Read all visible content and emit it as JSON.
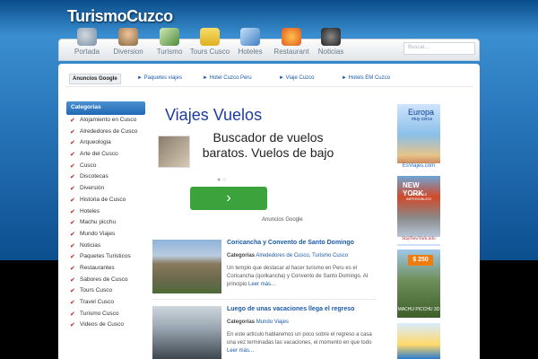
{
  "site": {
    "logo_text": "TurismoCuzco"
  },
  "nav": {
    "items": [
      {
        "label": "Portada",
        "icon": "home-icon",
        "color": "#7a8fa3"
      },
      {
        "label": "Diversion",
        "icon": "people-icon",
        "color": "#8c6b45"
      },
      {
        "label": "Turismo",
        "icon": "map-icon",
        "color": "#4f8b3a"
      },
      {
        "label": "Tours Cusco",
        "icon": "bus-icon",
        "color": "#e0b020"
      },
      {
        "label": "Hoteles",
        "icon": "hotel-icon",
        "color": "#3f7fc4"
      },
      {
        "label": "Restaurant",
        "icon": "food-icon",
        "color": "#e05a22"
      },
      {
        "label": "Noticias",
        "icon": "camera-icon",
        "color": "#333333"
      }
    ],
    "search_placeholder": "Buscar..."
  },
  "ads_bar": {
    "title": "Anuncios Google",
    "links": [
      "► Paquetes viajes",
      "► Hotel Cuzco Peru",
      "► Viaje Cuzco",
      "► Hotels EM Cuzco"
    ]
  },
  "sidebar": {
    "heading": "Categorias",
    "items": [
      "Alojamiento en Cusco",
      "Alrededores de Cusco",
      "Arqueologia",
      "Arte del Cusco",
      "Cusco",
      "Discotecas",
      "Diversión",
      "Historia de Cusco",
      "Hoteles",
      "Machu picchu",
      "Mundo Viajes",
      "Noticias",
      "Paquetes Turisticos",
      "Restaurantes",
      "Sabores de Cusco",
      "Tours Cusco",
      "Travel Cusco",
      "Turismo Cusco",
      "Videos de Cusco"
    ]
  },
  "google_ad": {
    "title": "Viajes Vuelos",
    "text": "Buscador de vuelos baratos. Vuelos de bajo",
    "button_label": "›",
    "dots": "● ○",
    "branding": "Anuncios Google"
  },
  "posts": [
    {
      "title": "Coricancha y Convento de Santo Domingo",
      "meta_prefix": "Categorías",
      "categories": "Alrededores de Cusco, Turismo Cusco",
      "excerpt": "Un templo que destacar al hacer turismo en Peru es el Coricancha (qorikancha) y Convento de Santo Domingo. Al principio",
      "more": "Leer más..."
    },
    {
      "title": "Luego de unas vacaciones llega el regreso",
      "meta_prefix": "Categorías",
      "categories": "Mundo Viajes",
      "excerpt": "En este articulo hablaremos un poco sobre el regreso a casa una vez terminadas las vacaciones, el momento en que todo",
      "more": "Leer más..."
    }
  ],
  "banners": {
    "europa": {
      "title": "Europa",
      "subtitle": "muy cerca",
      "footer": "EsViajes.com"
    },
    "newyork": {
      "title": "NEW YORK",
      "subtitle": "OFERTAS IMPERDIBLES!",
      "footer": "StayNewYork.info"
    },
    "machu": {
      "price": "$ 250",
      "footer": "MACHU PICCHU 3D"
    }
  }
}
